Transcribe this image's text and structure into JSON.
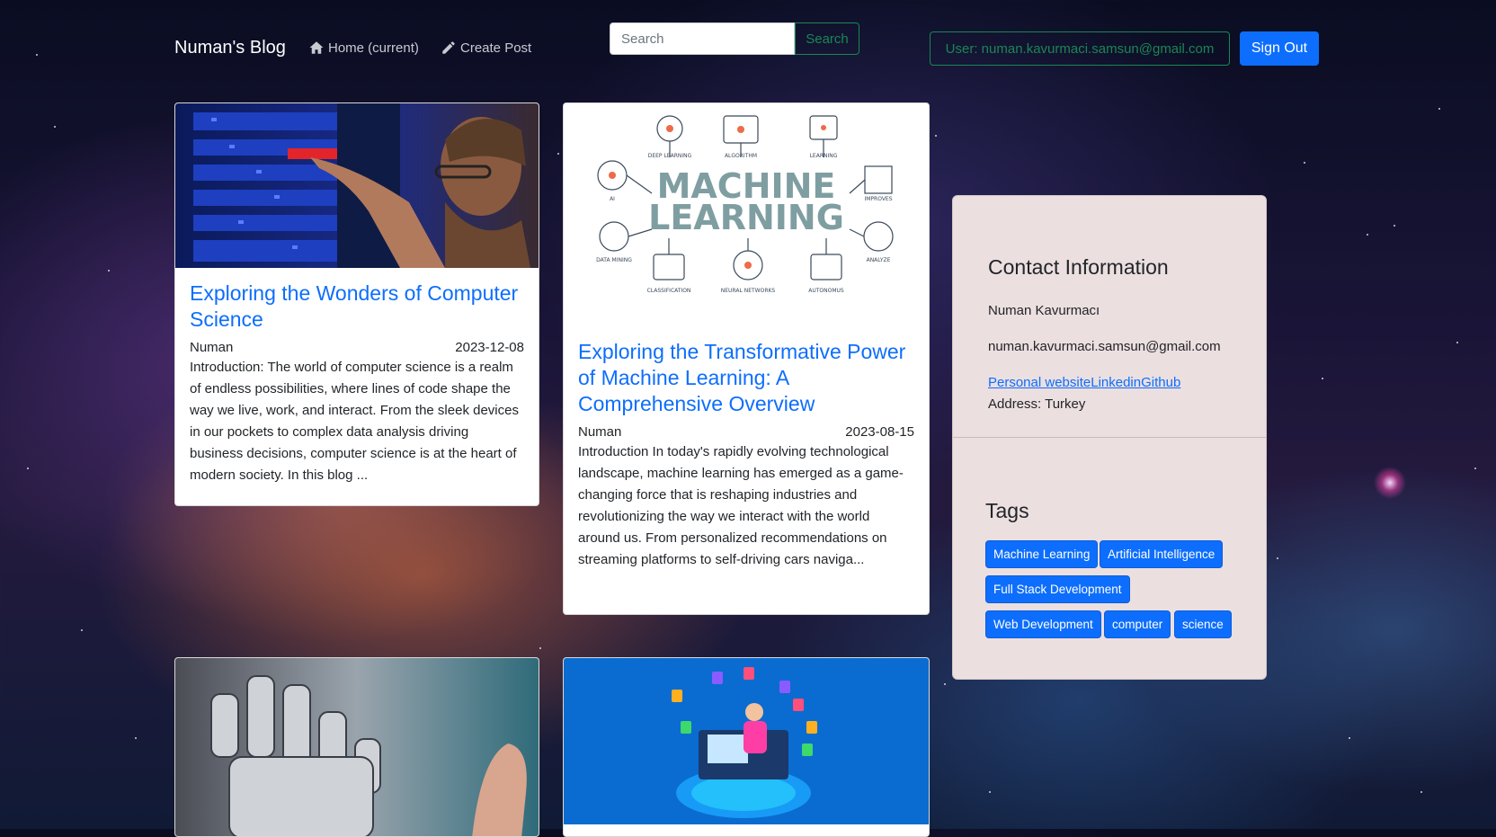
{
  "navbar": {
    "brand": "Numan's Blog",
    "home_label": "Home (current)",
    "create_post_label": "Create Post",
    "search_placeholder": "Search",
    "search_button": "Search",
    "user_label": "User: numan.kavurmaci.samsun@gmail.com",
    "signout_label": "Sign Out"
  },
  "posts": [
    {
      "title": "Exploring the Wonders of Computer Science",
      "author": "Numan",
      "date": "2023-12-08",
      "excerpt": "Introduction: The world of computer science is a realm of endless possibilities, where lines of code shape the way we live, work, and interact. From the sleek devices in our pockets to complex data analysis driving business decisions, computer science is at the heart of modern society. In this blog ..."
    },
    {
      "title": "Exploring the Transformative Power of Machine Learning: A Comprehensive Overview",
      "author": "Numan",
      "date": "2023-08-15",
      "excerpt": "Introduction In today's rapidly evolving technological landscape, machine learning has emerged as a game-changing force that is reshaping industries and revolutionizing the way we interact with the world around us. From personalized recommendations on streaming platforms to self-driving cars naviga..."
    }
  ],
  "ml_image": {
    "line1": "MACHINE",
    "line2": "LEARNING",
    "labels": [
      "DEEP LEARNING",
      "ALGORITHM",
      "LEARNING",
      "AI",
      "IMPROVES",
      "DATA MINING",
      "ANALYZE",
      "CLASSIFICATION",
      "NEURAL NETWORKS",
      "AUTONOMUS"
    ]
  },
  "sidebar": {
    "contact_title": "Contact Information",
    "name": "Numan Kavurmacı",
    "email": "numan.kavurmaci.samsun@gmail.com",
    "links": [
      "Personal website",
      "Linkedin",
      "Github"
    ],
    "address": "Address: Turkey",
    "tags_title": "Tags",
    "tags": [
      "Machine Learning",
      "Artificial Intelligence",
      "Full Stack Development",
      "Web Development",
      "computer",
      "science"
    ]
  },
  "colors": {
    "primary": "#0d6efd",
    "success": "#198754",
    "sidebar_bg": "#ecdfe0"
  }
}
